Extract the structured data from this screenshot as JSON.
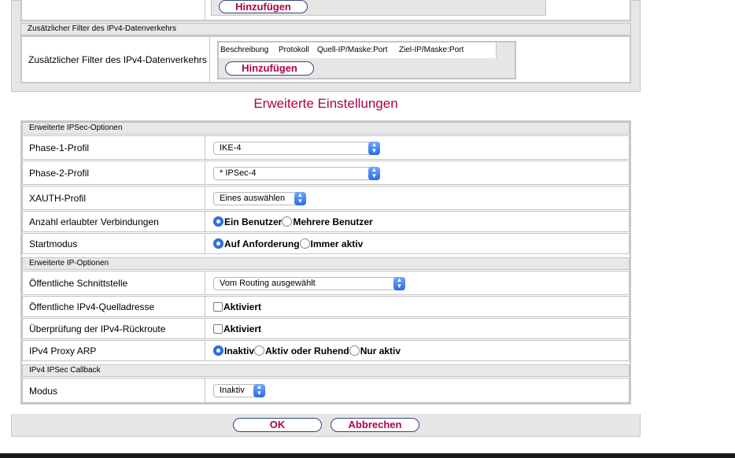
{
  "top_section": {
    "add_label": "Hinzufügen"
  },
  "filter": {
    "header": "Zusätzlicher Filter des IPv4-Datenverkehrs",
    "label": "Zusätzlicher Filter des IPv4-Datenverkehrs",
    "columns": [
      "Beschreibung",
      "Protokoll",
      "Quell-IP/Maske:Port",
      "Ziel-IP/Maske:Port"
    ],
    "add_label": "Hinzufügen"
  },
  "section_title": "Erweiterte Einstellungen",
  "ipsec": {
    "header": "Erweiterte IPSec-Optionen",
    "phase1": {
      "label": "Phase-1-Profil",
      "value": "IKE-4"
    },
    "phase2": {
      "label": "Phase-2-Profil",
      "value": "* IPSec-4"
    },
    "xauth": {
      "label": "XAUTH-Profil",
      "value": "Eines auswählen"
    },
    "connections": {
      "label": "Anzahl erlaubter Verbindungen",
      "options": [
        "Ein Benutzer",
        "Mehrere Benutzer"
      ],
      "selected": "Ein Benutzer"
    },
    "startmode": {
      "label": "Startmodus",
      "options": [
        "Auf Anforderung",
        "Immer aktiv"
      ],
      "selected": "Auf Anforderung"
    }
  },
  "ip": {
    "header": "Erweiterte IP-Optionen",
    "iface": {
      "label": "Öffentliche Schnittstelle",
      "value": "Vom Routing ausgewählt"
    },
    "src": {
      "label": "Öffentliche IPv4-Quelladresse",
      "checkbox": "Aktiviert",
      "checked": false
    },
    "rpf": {
      "label": "Überprüfung der IPv4-Rückroute",
      "checkbox": "Aktiviert",
      "checked": false
    },
    "arp": {
      "label": "IPv4 Proxy ARP",
      "options": [
        "Inaktiv",
        "Aktiv oder Ruhend",
        "Nur aktiv"
      ],
      "selected": "Inaktiv"
    }
  },
  "callback": {
    "header": "IPv4 IPSec Callback",
    "mode": {
      "label": "Modus",
      "value": "Inaktiv"
    }
  },
  "footer": {
    "ok_label": "OK",
    "cancel_label": "Abbrechen"
  }
}
